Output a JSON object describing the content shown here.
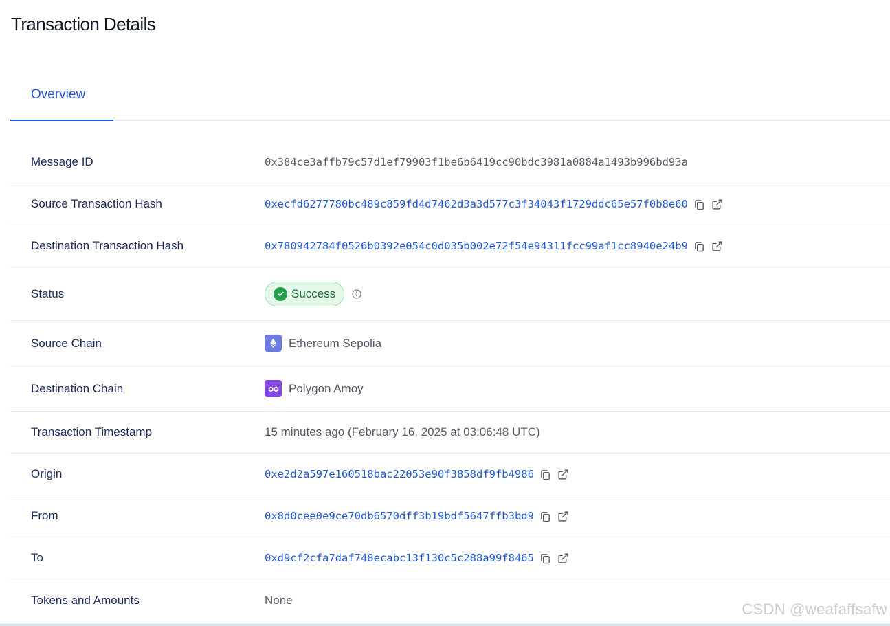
{
  "page": {
    "title": "Transaction Details"
  },
  "tabs": [
    {
      "label": "Overview",
      "active": true
    }
  ],
  "rows": {
    "message_id": {
      "label": "Message ID",
      "value": "0x384ce3affb79c57d1ef79903f1be6b6419cc90bdc3981a0884a1493b996bd93a"
    },
    "source_tx_hash": {
      "label": "Source Transaction Hash",
      "value": "0xecfd6277780bc489c859fd4d7462d3a3d577c3f34043f1729ddc65e57f0b8e60"
    },
    "dest_tx_hash": {
      "label": "Destination Transaction Hash",
      "value": "0x780942784f0526b0392e054c0d035b002e72f54e94311fcc99af1cc8940e24b9"
    },
    "status": {
      "label": "Status",
      "value": "Success",
      "color": "#22a04a"
    },
    "source_chain": {
      "label": "Source Chain",
      "value": "Ethereum Sepolia",
      "icon": "ethereum-icon"
    },
    "dest_chain": {
      "label": "Destination Chain",
      "value": "Polygon Amoy",
      "icon": "polygon-icon"
    },
    "timestamp": {
      "label": "Transaction Timestamp",
      "value": "15 minutes ago (February 16, 2025 at 03:06:48 UTC)"
    },
    "origin": {
      "label": "Origin",
      "value": "0xe2d2a597e160518bac22053e90f3858df9fb4986"
    },
    "from": {
      "label": "From",
      "value": "0x8d0cee0e9ce70db6570dff3b19bdf5647ffb3bd9"
    },
    "to": {
      "label": "To",
      "value": "0xd9cf2cfa7daf748ecabc13f130c5c288a99f8465"
    },
    "tokens": {
      "label": "Tokens and Amounts",
      "value": "None"
    }
  },
  "watermark": "CSDN @weafaffsafw",
  "colors": {
    "accent": "#2456e4",
    "link": "#1f5ad8",
    "success_bg": "#e5f8ea"
  }
}
